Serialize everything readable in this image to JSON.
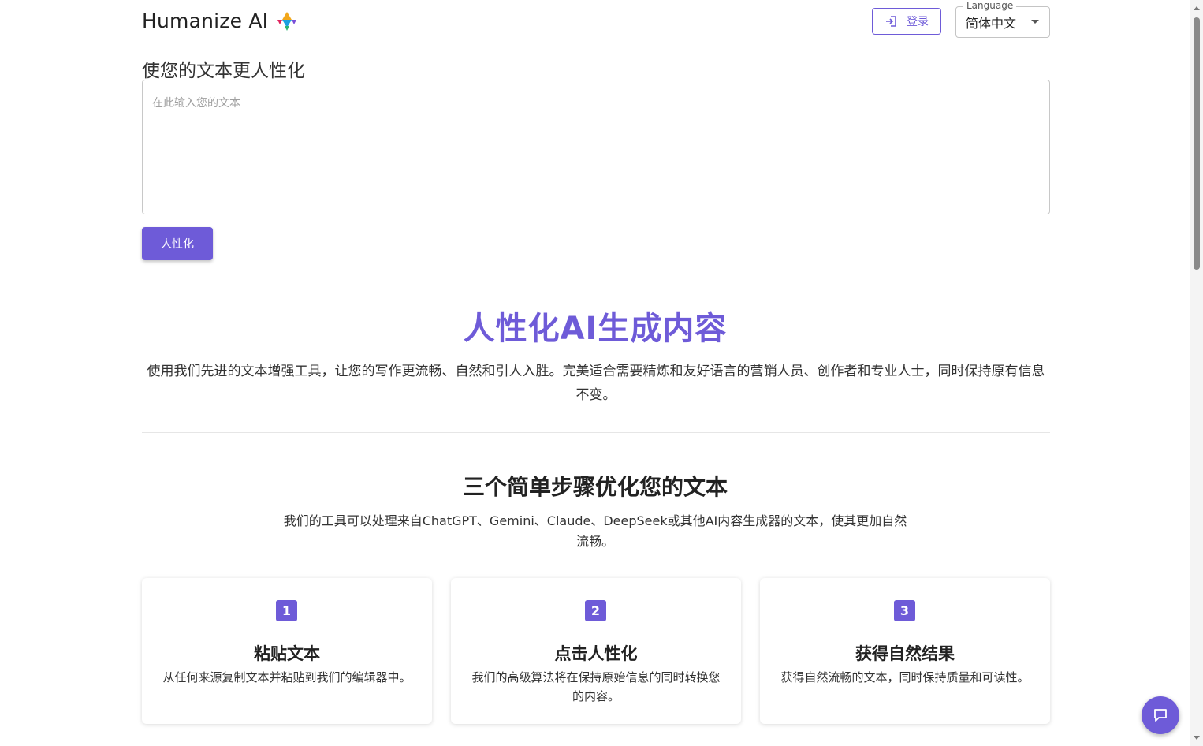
{
  "header": {
    "brand_title": "Humanize AI",
    "logo_icon": "colorful-logo-icon",
    "login_label": "登录",
    "language": {
      "legend": "Language",
      "selected": "简体中文"
    }
  },
  "editor": {
    "title": "使您的文本更人性化",
    "placeholder": "在此输入您的文本",
    "value": "",
    "submit_label": "人性化"
  },
  "hero": {
    "title": "人性化AI生成内容",
    "description": "使用我们先进的文本增强工具，让您的写作更流畅、自然和引人入胜。完美适合需要精炼和友好语言的营销人员、创作者和专业人士，同时保持原有信息不变。"
  },
  "steps": {
    "title": "三个简单步骤优化您的文本",
    "description": "我们的工具可以处理来自ChatGPT、Gemini、Claude、DeepSeek或其他AI内容生成器的文本，使其更加自然流畅。",
    "cards": [
      {
        "number": "1",
        "title": "粘贴文本",
        "description": "从任何来源复制文本并粘贴到我们的编辑器中。"
      },
      {
        "number": "2",
        "title": "点击人性化",
        "description": "我们的高级算法将在保持原始信息的同时转换您的内容。"
      },
      {
        "number": "3",
        "title": "获得自然结果",
        "description": "获得自然流畅的文本，同时保持质量和可读性。"
      }
    ]
  },
  "colors": {
    "accent": "#6e5bd8"
  }
}
